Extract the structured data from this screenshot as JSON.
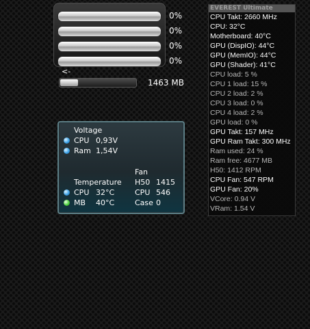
{
  "cpu_meter": {
    "cores": [
      {
        "percent_label": "0%",
        "usage": 0.0
      },
      {
        "percent_label": "0%",
        "usage": 0.0
      },
      {
        "percent_label": "0%",
        "usage": 0.0
      },
      {
        "percent_label": "0%",
        "usage": 0.0
      }
    ],
    "arrow_label": "<-",
    "memory_label": "1463 MB",
    "memory_usage": 0.24
  },
  "sensor": {
    "voltage_title": "Voltage",
    "voltages": [
      {
        "name": "CPU",
        "value": "0,93V",
        "icon": "blue-status-icon"
      },
      {
        "name": "Ram",
        "value": "1,54V",
        "icon": "blue-status-icon"
      }
    ],
    "fan_title": "Fan",
    "temperature_title": "Temperature",
    "temps": [
      {
        "name": "CPU",
        "value": "32°C",
        "icon": "blue-status-icon"
      },
      {
        "name": "MB",
        "value": "40°C",
        "icon": "green-status-icon"
      }
    ],
    "fans": [
      {
        "name": "H50",
        "value": "1415"
      },
      {
        "name": "CPU",
        "value": "546"
      },
      {
        "name": "Case",
        "value": "0"
      }
    ]
  },
  "everest": {
    "title": "EVEREST Ultimate",
    "lines": [
      {
        "text": "CPU Takt: 2660 MHz",
        "style": "white"
      },
      {
        "text": "CPU: 32°C",
        "style": "white"
      },
      {
        "text": "Motherboard: 40°C",
        "style": "white"
      },
      {
        "text": "GPU (DispIO): 44°C",
        "style": "white"
      },
      {
        "text": "GPU (MemIO): 44°C",
        "style": "white"
      },
      {
        "text": "GPU (Shader): 41°C",
        "style": "white"
      },
      {
        "text": "CPU load: 5 %",
        "style": "grey"
      },
      {
        "text": "CPU 1 load: 15 %",
        "style": "grey"
      },
      {
        "text": "CPU 2 load: 2 %",
        "style": "grey"
      },
      {
        "text": "CPU 3 load: 0 %",
        "style": "grey"
      },
      {
        "text": "CPU 4 load: 2 %",
        "style": "grey"
      },
      {
        "text": "GPU load: 0 %",
        "style": "grey"
      },
      {
        "text": "GPU Takt: 157 MHz",
        "style": "white"
      },
      {
        "text": "GPU Ram Takt: 300 MHz",
        "style": "white"
      },
      {
        "text": "Ram used: 24 %",
        "style": "grey"
      },
      {
        "text": "Ram free: 4677 MB",
        "style": "grey"
      },
      {
        "text": "H50: 1412 RPM",
        "style": "grey"
      },
      {
        "text": "CPU Fan: 547 RPM",
        "style": "white"
      },
      {
        "text": "GPU Fan: 20%",
        "style": "white"
      },
      {
        "text": "VCore: 0.94 V",
        "style": "grey"
      },
      {
        "text": "VRam: 1.54 V",
        "style": "grey"
      }
    ]
  },
  "colors": {
    "everest_text_white": "#ffffff",
    "everest_text_grey": "#b8b8b8",
    "sensor_border": "#5d7f86"
  }
}
